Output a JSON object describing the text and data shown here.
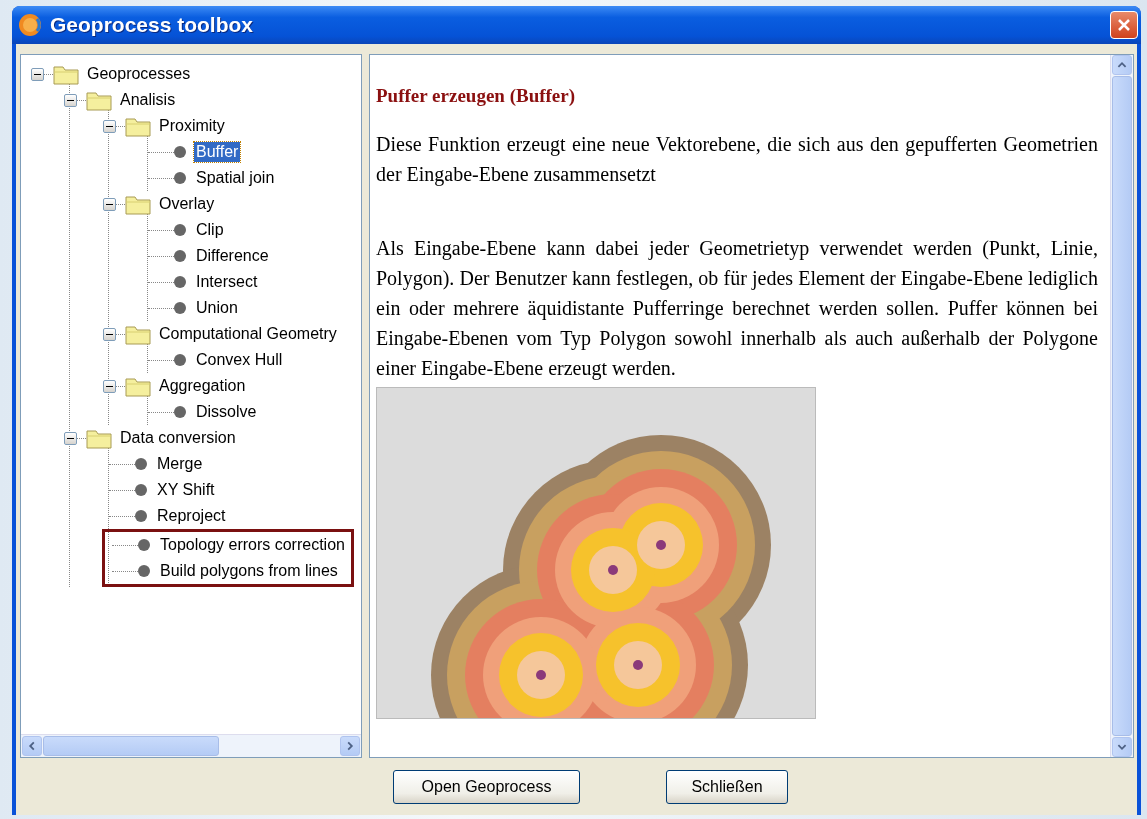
{
  "window": {
    "title": "Geoprocess toolbox"
  },
  "tree": [
    {
      "label": "Geoprocesses",
      "kind": "folder",
      "expanded": true,
      "children": [
        {
          "label": "Analisis",
          "kind": "folder",
          "expanded": true,
          "children": [
            {
              "label": "Proximity",
              "kind": "folder",
              "expanded": true,
              "children": [
                {
                  "label": "Buffer",
                  "kind": "process",
                  "selected": true,
                  "highlighted": false
                },
                {
                  "label": "Spatial join",
                  "kind": "process",
                  "selected": false,
                  "highlighted": false
                }
              ]
            },
            {
              "label": "Overlay",
              "kind": "folder",
              "expanded": true,
              "children": [
                {
                  "label": "Clip",
                  "kind": "process",
                  "selected": false,
                  "highlighted": false
                },
                {
                  "label": "Difference",
                  "kind": "process",
                  "selected": false,
                  "highlighted": false
                },
                {
                  "label": "Intersect",
                  "kind": "process",
                  "selected": false,
                  "highlighted": false
                },
                {
                  "label": "Union",
                  "kind": "process",
                  "selected": false,
                  "highlighted": false
                }
              ]
            },
            {
              "label": "Computational Geometry",
              "kind": "folder",
              "expanded": true,
              "children": [
                {
                  "label": "Convex Hull",
                  "kind": "process",
                  "selected": false,
                  "highlighted": false
                }
              ]
            },
            {
              "label": "Aggregation",
              "kind": "folder",
              "expanded": true,
              "children": [
                {
                  "label": "Dissolve",
                  "kind": "process",
                  "selected": false,
                  "highlighted": false
                }
              ]
            }
          ]
        },
        {
          "label": "Data conversion",
          "kind": "folder",
          "expanded": true,
          "children": [
            {
              "label": "Merge",
              "kind": "process",
              "selected": false,
              "highlighted": false
            },
            {
              "label": "XY Shift",
              "kind": "process",
              "selected": false,
              "highlighted": false
            },
            {
              "label": "Reproject",
              "kind": "process",
              "selected": false,
              "highlighted": false
            },
            {
              "label": "Topology errors correction",
              "kind": "process",
              "selected": false,
              "highlighted": true
            },
            {
              "label": "Build polygons from lines",
              "kind": "process",
              "selected": false,
              "highlighted": true
            }
          ]
        }
      ]
    }
  ],
  "help": {
    "heading": "Puffer erzeugen (Buffer)",
    "paragraphs": [
      "Diese Funktion erzeugt eine neue Vektorebene, die sich aus den gepufferten Geometrien der Eingabe-Ebene zusammensetzt",
      "Als Eingabe-Ebene kann dabei jeder Geometrietyp verwendet werden (Punkt, Linie, Polygon). Der Benutzer kann festlegen, ob für jedes Element der Eingabe-Ebene lediglich ein oder mehrere äquidistante Pufferringe berechnet werden sollen. Puffer können bei Eingabe-Ebenen vom Typ Polygon sowohl innerhalb als auch außerhalb der Polygone einer Eingabe-Ebene erzeugt werden."
    ]
  },
  "buttons": [
    {
      "label": "Open Geoprocess"
    },
    {
      "label": "Schließen"
    }
  ]
}
